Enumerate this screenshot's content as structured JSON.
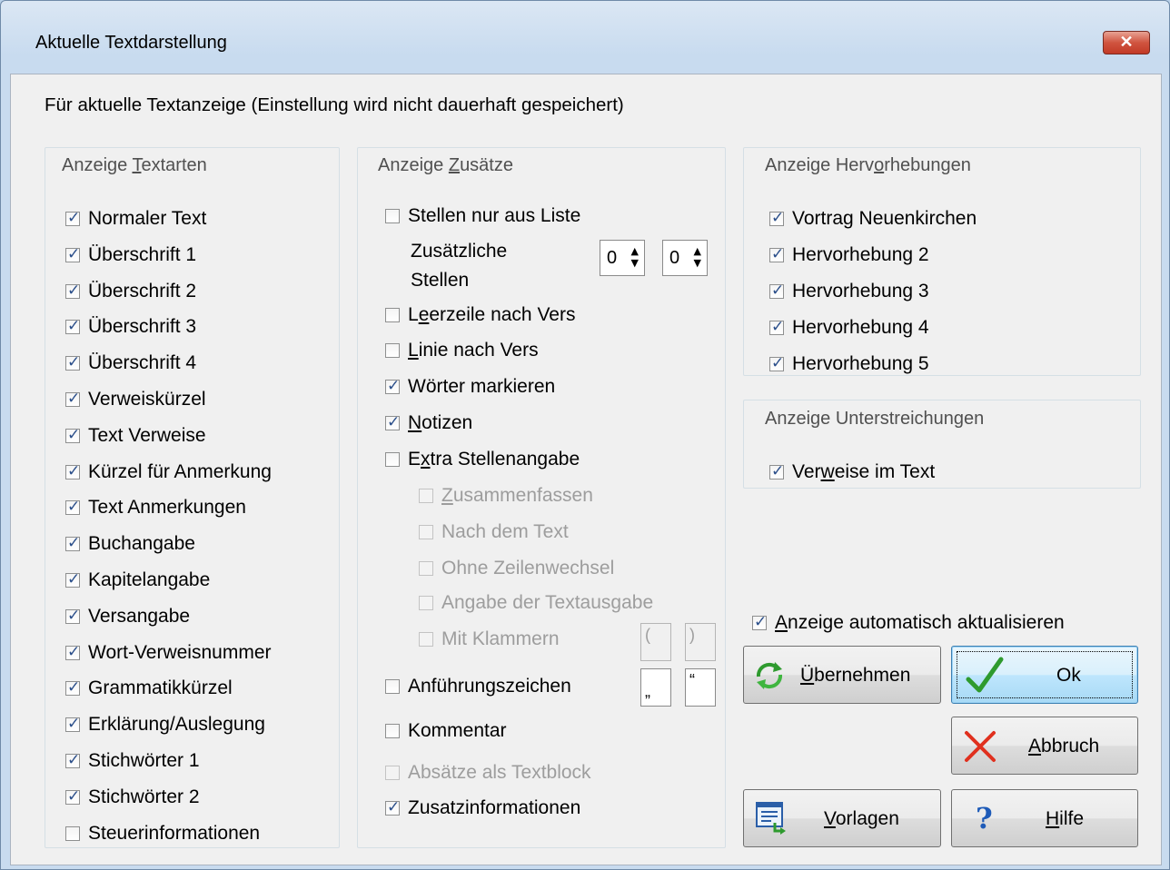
{
  "window": {
    "title": "Aktuelle Textdarstellung",
    "close_glyph": "✕"
  },
  "subtitle": "Für aktuelle Textanzeige (Einstellung wird nicht dauerhaft gespeichert)",
  "textarten": {
    "title_pre": "Anzeige ",
    "title_u": "T",
    "title_post": "extarten",
    "items": [
      {
        "label": "Normaler Text",
        "checked": true
      },
      {
        "label": "Überschrift 1",
        "checked": true
      },
      {
        "label": "Überschrift 2",
        "checked": true
      },
      {
        "label": "Überschrift 3",
        "checked": true
      },
      {
        "label": "Überschrift 4",
        "checked": true
      },
      {
        "label": "Verweiskürzel",
        "checked": true
      },
      {
        "label": "Text Verweise",
        "checked": true
      },
      {
        "label": "Kürzel für Anmerkung",
        "checked": true
      },
      {
        "label": "Text Anmerkungen",
        "checked": true
      },
      {
        "label": "Buchangabe",
        "checked": true
      },
      {
        "label": "Kapitelangabe",
        "checked": true
      },
      {
        "label": "Versangabe",
        "checked": true
      },
      {
        "label": "Wort-Verweisnummer",
        "checked": true
      },
      {
        "label": "Grammatikkürzel",
        "checked": true
      },
      {
        "label": "Erklärung/Auslegung",
        "checked": true
      },
      {
        "label": "Stichwörter 1",
        "checked": true
      },
      {
        "label": "Stichwörter 2",
        "checked": true
      },
      {
        "label": "Steuerinformationen",
        "checked": false
      }
    ]
  },
  "zusaetze": {
    "title_pre": "Anzeige ",
    "title_u": "Z",
    "title_post": "usätze",
    "stellen_liste": {
      "label": "Stellen nur aus Liste",
      "checked": false
    },
    "zusaetzliche_line1": "Zusätzliche",
    "zusaetzliche_line2": "Stellen",
    "spin1": "0",
    "spin2": "0",
    "leerzeile": {
      "pre": "L",
      "u": "e",
      "post": "erzeile nach Vers",
      "checked": false
    },
    "linie": {
      "pre": "",
      "u": "L",
      "post": "inie nach Vers",
      "checked": false
    },
    "woerter": {
      "label": "Wörter markieren",
      "checked": true
    },
    "notizen": {
      "pre": "",
      "u": "N",
      "post": "otizen",
      "checked": true
    },
    "extra": {
      "pre": "E",
      "u": "x",
      "post": "tra Stellenangabe",
      "checked": false
    },
    "zusammenfassen": {
      "pre": "",
      "u": "Z",
      "post": "usammenfassen",
      "checked": false
    },
    "nach_text": {
      "label": "Nach dem Text",
      "checked": false
    },
    "ohne_zeilen": {
      "label": "Ohne Zeilenwechsel",
      "checked": false
    },
    "angabe_textausgabe": {
      "label": "Angabe der Textausgabe",
      "checked": false
    },
    "klammern": {
      "label": "Mit Klammern",
      "checked": false
    },
    "klammer_open": "(",
    "klammer_close": ")",
    "anfuehrung": {
      "label": "Anführungszeichen",
      "checked": false
    },
    "quote_open": "„",
    "quote_close": "“",
    "kommentar": {
      "label": "Kommentar",
      "checked": false
    },
    "absaetze": {
      "label": "Absätze als Textblock",
      "checked": false
    },
    "zusatzinfo": {
      "label": "Zusatzinformationen",
      "checked": true
    }
  },
  "hervorhebungen": {
    "title_pre": "Anzeige Herv",
    "title_u": "o",
    "title_post": "rhebungen",
    "items": [
      {
        "label": "Vortrag Neuenkirchen",
        "checked": true
      },
      {
        "label": "Hervorhebung 2",
        "checked": true
      },
      {
        "label": "Hervorhebung 3",
        "checked": true
      },
      {
        "label": "Hervorhebung 4",
        "checked": true
      },
      {
        "label": "Hervorhebung 5",
        "checked": true
      }
    ]
  },
  "unterstreichungen": {
    "title": "Anzeige Unterstreichungen",
    "item": {
      "pre": "Ver",
      "u": "w",
      "post": "eise im Text",
      "checked": true
    }
  },
  "auto": {
    "pre": "",
    "u": "A",
    "post": "nzeige automatisch aktualisieren",
    "checked": true
  },
  "buttons": {
    "uebernehmen": {
      "pre": "",
      "u": "Ü",
      "post": "bernehmen",
      "icon": "refresh-arrows-icon"
    },
    "ok": {
      "label": "Ok",
      "icon": "checkmark-icon"
    },
    "abbruch": {
      "pre": "",
      "u": "A",
      "post": "bbruch",
      "icon": "red-x-icon"
    },
    "vorlagen": {
      "pre": "",
      "u": "V",
      "post": "orlagen",
      "icon": "list-template-icon"
    },
    "hilfe": {
      "pre": "",
      "u": "H",
      "post": "ilfe",
      "icon": "question-mark-icon"
    }
  },
  "colors": {
    "accent": "#3c7fb1",
    "check": "#2a4e8a",
    "close": "#c23a26",
    "ok_green": "#2e9a2e",
    "cancel_red": "#e0301e"
  }
}
